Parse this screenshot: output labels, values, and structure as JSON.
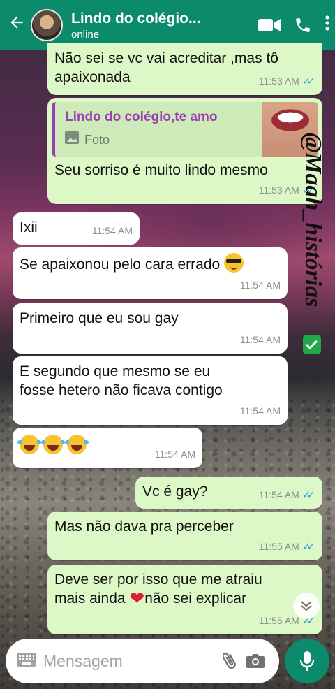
{
  "header": {
    "contact_name": "Lindo do colégio...",
    "status": "online",
    "back_icon": "arrow-left-icon",
    "video_icon": "video-camera-icon",
    "call_icon": "phone-icon",
    "menu_icon": "more-vert-icon"
  },
  "messages": [
    {
      "text_l1": "Não sei se vc vai acreditar ,mas tô",
      "text_l2": "apaixonada",
      "time": "11:53 AM"
    },
    {
      "quote_author": "Lindo do colégio,te amo",
      "quote_type": "Foto",
      "text": "Seu sorriso é muito lindo mesmo",
      "time": "11:53 AM"
    },
    {
      "text": "Ixii",
      "time": "11:54 AM"
    },
    {
      "text": "Se apaixonou pelo cara errado",
      "time": "11:54 AM"
    },
    {
      "text": "Primeiro que eu sou gay",
      "time": "11:54 AM"
    },
    {
      "text_l1": "E segundo que mesmo se eu",
      "text_l2": "fosse hetero não ficava contigo",
      "time": "11:54 AM"
    },
    {
      "text": "",
      "time": "11:54 AM"
    },
    {
      "text": "Vc é gay?",
      "time": "11:54 AM"
    },
    {
      "text": "Mas não dava pra perceber",
      "time": "11:55 AM"
    },
    {
      "text_l1": "Deve ser por isso que me atraiu",
      "text_l2a": "mais ainda ",
      "text_l2b": "não sei explicar",
      "time": "11:55 AM"
    }
  ],
  "watermark": "@Maah_histórias",
  "input": {
    "placeholder": "Mensagem"
  },
  "colors": {
    "header": "#0b8a6c",
    "outgoing": "#dcf8c6",
    "incoming": "#ffffff",
    "read_ticks": "#39a0e0",
    "quote_accent": "#9b3fb5"
  }
}
